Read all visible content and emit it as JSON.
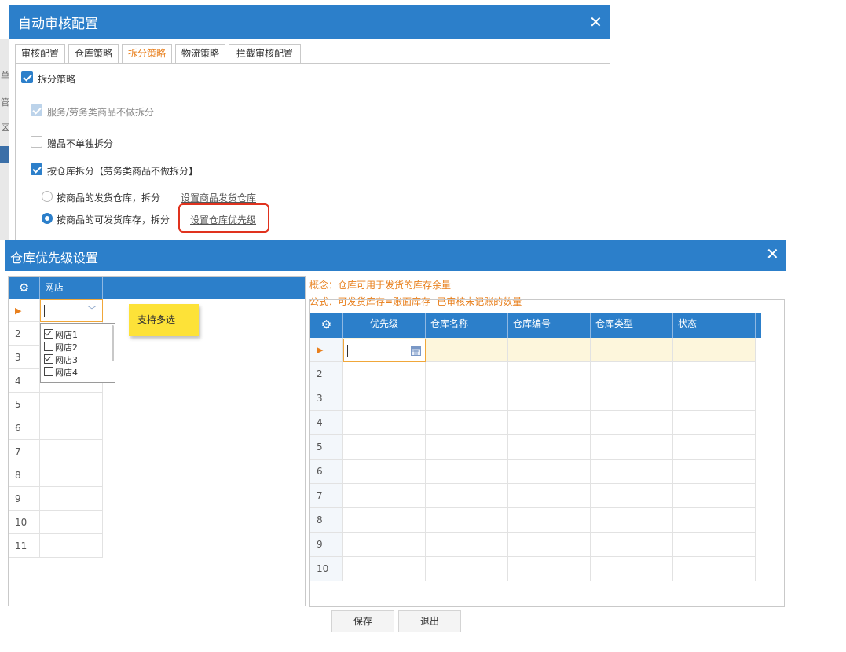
{
  "background_strip": {
    "chars": [
      "单",
      "管",
      "区"
    ]
  },
  "dialog1": {
    "title": "自动审核配置",
    "tabs": [
      "审核配置",
      "仓库策略",
      "拆分策略",
      "物流策略",
      "拦截审核配置"
    ],
    "active_tab": "拆分策略",
    "split_strategy": {
      "label": "拆分策略",
      "checked": true
    },
    "service_no_split": {
      "label": "服务/劳务类商品不做拆分",
      "checked": true,
      "disabled": true
    },
    "gift_no_split": {
      "label": "赠品不单独拆分",
      "checked": false
    },
    "split_by_warehouse": {
      "label": "按仓库拆分【劳务类商品不做拆分】",
      "checked": true
    },
    "radio_ship_warehouse": {
      "label": "按商品的发货仓库，拆分",
      "selected": false,
      "link": "设置商品发货仓库"
    },
    "radio_available_stock": {
      "label": "按商品的可发货库存，拆分",
      "selected": true,
      "link": "设置仓库优先级"
    }
  },
  "dialog2": {
    "title": "仓库优先级设置",
    "left_grid": {
      "column_header": "网店",
      "row_numbers": [
        "2",
        "3",
        "4",
        "5",
        "6",
        "7",
        "8",
        "9",
        "10",
        "11"
      ],
      "dropdown_options": [
        {
          "label": "网店1",
          "checked": true
        },
        {
          "label": "网店2",
          "checked": false
        },
        {
          "label": "网店3",
          "checked": true
        },
        {
          "label": "网店4",
          "checked": false
        }
      ]
    },
    "note": "支持多选",
    "concept": "概念：仓库可用于发货的库存余量",
    "formula": "公式：可发货库存=账面库存- 已审核未记账的数量",
    "right_grid": {
      "columns": [
        "优先级",
        "仓库名称",
        "仓库编号",
        "仓库类型",
        "状态"
      ],
      "row_numbers": [
        "2",
        "3",
        "4",
        "5",
        "6",
        "7",
        "8",
        "9",
        "10"
      ]
    },
    "buttons": {
      "save": "保存",
      "exit": "退出"
    }
  },
  "colors": {
    "title_bar": "#2c7fca",
    "accent_orange": "#e87f1c",
    "highlight_red": "#e0321e",
    "note_yellow": "#fde238"
  },
  "icons": {
    "close": "close-icon",
    "gear": "gear-icon",
    "current_row": "play-arrow-icon",
    "dropdown": "chevron-down-icon",
    "calendar": "calendar-icon"
  }
}
